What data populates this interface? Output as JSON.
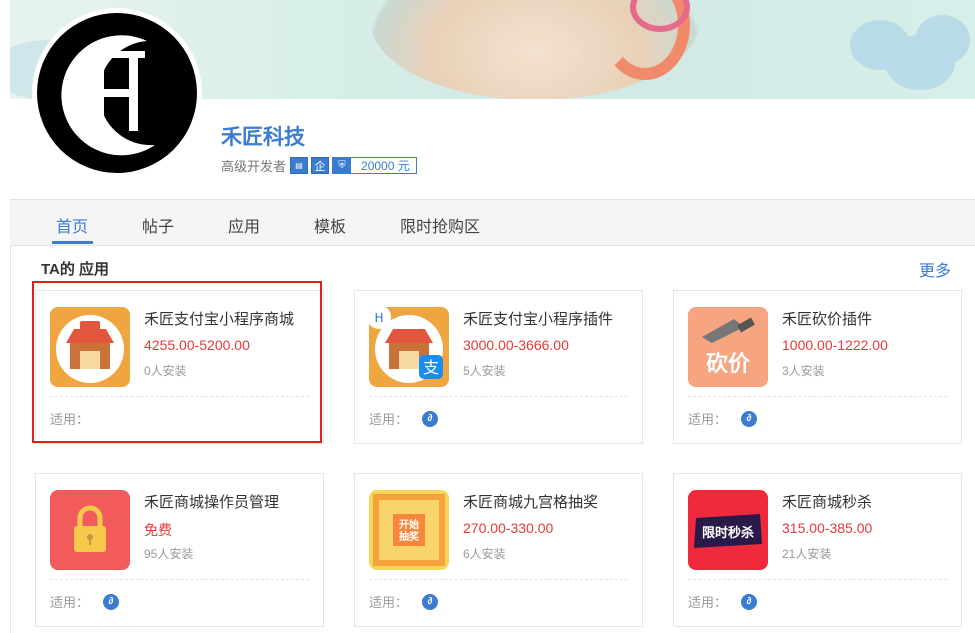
{
  "header": {
    "company_name": "禾匠科技",
    "level": "高级开发者",
    "badge_id": "ID",
    "badge_enterprise": "企",
    "deposit_amount": "20000 元",
    "avatar_letter": "H"
  },
  "tabs": [
    {
      "label": "首页",
      "active": true
    },
    {
      "label": "帖子",
      "active": false
    },
    {
      "label": "应用",
      "active": false
    },
    {
      "label": "模板",
      "active": false
    },
    {
      "label": "限时抢购区",
      "active": false
    }
  ],
  "section": {
    "title": "TA的 应用",
    "more": "更多"
  },
  "applies_label": "适用：",
  "apps": [
    {
      "title": "禾匠支付宝小程序商城",
      "price": "4255.00-5200.00",
      "installs": "0人安装",
      "icon": "store-icon",
      "has_platform": false
    },
    {
      "title": "禾匠支付宝小程序插件",
      "price": "3000.00-3666.00",
      "installs": "5人安装",
      "icon": "alipay-store-icon",
      "has_platform": true
    },
    {
      "title": "禾匠砍价插件",
      "price": "1000.00-1222.00",
      "installs": "3人安装",
      "icon": "bargain-icon",
      "icon_text": "砍价",
      "has_platform": true
    },
    {
      "title": "禾匠商城操作员管理",
      "price": "免费",
      "installs": "95人安装",
      "icon": "lock-icon",
      "has_platform": true
    },
    {
      "title": "禾匠商城九宫格抽奖",
      "price": "270.00-330.00",
      "installs": "6人安装",
      "icon": "lottery-icon",
      "icon_text": "开始抽奖",
      "has_platform": true
    },
    {
      "title": "禾匠商城秒杀",
      "price": "315.00-385.00",
      "installs": "21人安装",
      "icon": "flash-sale-icon",
      "icon_text": "限时秒杀",
      "has_platform": true
    }
  ],
  "colors": {
    "accent": "#3a7dd0",
    "price": "#e43a3a",
    "highlight": "#e01e1e"
  }
}
